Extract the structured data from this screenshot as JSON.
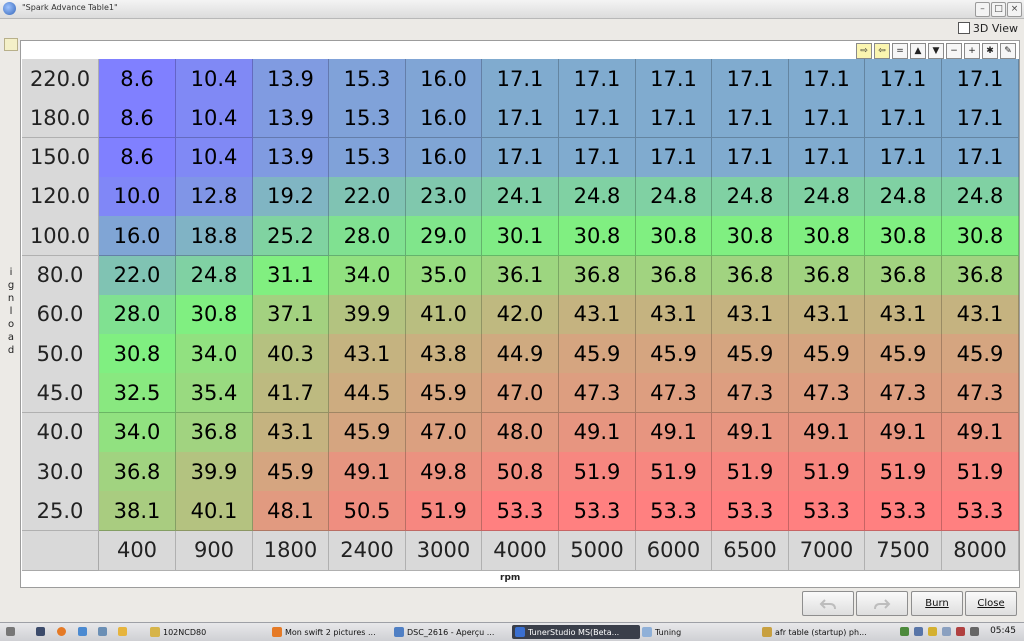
{
  "window": {
    "title": "\"Spark Advance Table1\""
  },
  "view3d_label": "3D View",
  "toolbar_icons": [
    "arrow-right-icon",
    "arrow-left-icon",
    "minus-icon",
    "up-icon",
    "down-icon",
    "decrement-icon",
    "increment-icon",
    "multiply-icon",
    "pen-icon"
  ],
  "toolbar_glyphs": [
    "⇨",
    "⇦",
    "=",
    "▲",
    "▼",
    "−",
    "+",
    "✱",
    "✎"
  ],
  "y_axis": {
    "label": "igNload",
    "label_chars": [
      "i",
      "g",
      "n",
      "l",
      "o",
      "a",
      "d"
    ]
  },
  "x_axis": {
    "label": "rpm"
  },
  "table": {
    "load": [
      "220.0",
      "180.0",
      "150.0",
      "120.0",
      "100.0",
      "80.0",
      "60.0",
      "50.0",
      "45.0",
      "40.0",
      "30.0",
      "25.0"
    ],
    "rpm": [
      "400",
      "900",
      "1800",
      "2400",
      "3000",
      "4000",
      "5000",
      "6000",
      "6500",
      "7000",
      "7500",
      "8000"
    ],
    "values": [
      [
        "8.6",
        "10.4",
        "13.9",
        "15.3",
        "16.0",
        "17.1",
        "17.1",
        "17.1",
        "17.1",
        "17.1",
        "17.1",
        "17.1"
      ],
      [
        "8.6",
        "10.4",
        "13.9",
        "15.3",
        "16.0",
        "17.1",
        "17.1",
        "17.1",
        "17.1",
        "17.1",
        "17.1",
        "17.1"
      ],
      [
        "8.6",
        "10.4",
        "13.9",
        "15.3",
        "16.0",
        "17.1",
        "17.1",
        "17.1",
        "17.1",
        "17.1",
        "17.1",
        "17.1"
      ],
      [
        "10.0",
        "12.8",
        "19.2",
        "22.0",
        "23.0",
        "24.1",
        "24.8",
        "24.8",
        "24.8",
        "24.8",
        "24.8",
        "24.8"
      ],
      [
        "16.0",
        "18.8",
        "25.2",
        "28.0",
        "29.0",
        "30.1",
        "30.8",
        "30.8",
        "30.8",
        "30.8",
        "30.8",
        "30.8"
      ],
      [
        "22.0",
        "24.8",
        "31.1",
        "34.0",
        "35.0",
        "36.1",
        "36.8",
        "36.8",
        "36.8",
        "36.8",
        "36.8",
        "36.8"
      ],
      [
        "28.0",
        "30.8",
        "37.1",
        "39.9",
        "41.0",
        "42.0",
        "43.1",
        "43.1",
        "43.1",
        "43.1",
        "43.1",
        "43.1"
      ],
      [
        "30.8",
        "34.0",
        "40.3",
        "43.1",
        "43.8",
        "44.9",
        "45.9",
        "45.9",
        "45.9",
        "45.9",
        "45.9",
        "45.9"
      ],
      [
        "32.5",
        "35.4",
        "41.7",
        "44.5",
        "45.9",
        "47.0",
        "47.3",
        "47.3",
        "47.3",
        "47.3",
        "47.3",
        "47.3"
      ],
      [
        "34.0",
        "36.8",
        "43.1",
        "45.9",
        "47.0",
        "48.0",
        "49.1",
        "49.1",
        "49.1",
        "49.1",
        "49.1",
        "49.1"
      ],
      [
        "36.8",
        "39.9",
        "45.9",
        "49.1",
        "49.8",
        "50.8",
        "51.9",
        "51.9",
        "51.9",
        "51.9",
        "51.9",
        "51.9"
      ],
      [
        "38.1",
        "40.1",
        "48.1",
        "50.5",
        "51.9",
        "53.3",
        "53.3",
        "53.3",
        "53.3",
        "53.3",
        "53.3",
        "53.3"
      ]
    ]
  },
  "colors": {
    "low": "#8080ff",
    "mid": "#80f080",
    "high": "#ff8080"
  },
  "buttons": {
    "undo": "undo-icon",
    "redo": "redo-icon",
    "burn": "Burn",
    "close": "Close"
  },
  "taskbar": {
    "items": [
      {
        "label": "102NCD80",
        "icon": "folder-icon"
      },
      {
        "label": "Mon swift 2 pictures ...",
        "icon": "firefox-icon"
      },
      {
        "label": "DSC_2616 - Aperçu ...",
        "icon": "image-viewer-icon"
      },
      {
        "label": "TunerStudio MS(Beta...",
        "icon": "tunerstudio-icon",
        "active": true
      },
      {
        "label": "Tuning",
        "icon": "window-icon"
      },
      {
        "label": "afr table (startup) ph...",
        "icon": "paint-icon"
      }
    ],
    "clock": "05:45"
  }
}
